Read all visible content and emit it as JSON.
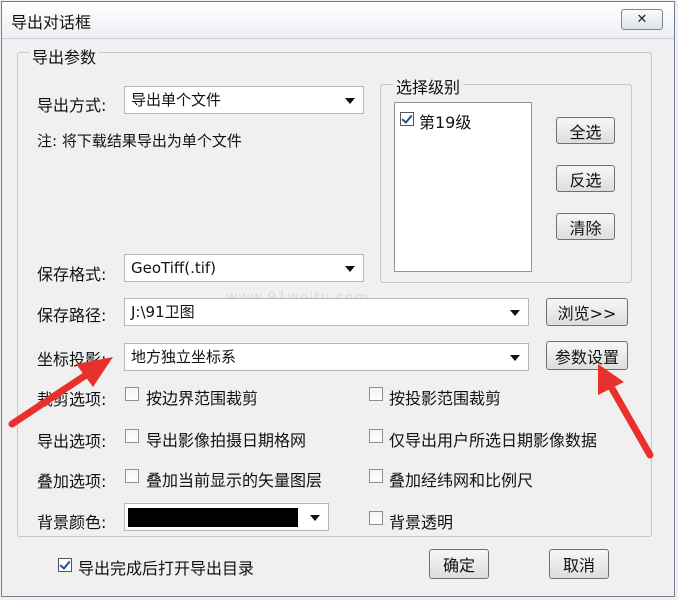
{
  "window": {
    "title": "导出对话框",
    "close_icon": "close-icon"
  },
  "export_params": {
    "legend": "导出参数",
    "export_mode_label": "导出方式:",
    "export_mode_value": "导出单个文件",
    "note": "注: 将下载结果导出为单个文件",
    "save_format_label": "保存格式:",
    "save_format_value": "GeoTiff(.tif)",
    "save_path_label": "保存路径:",
    "save_path_value": "J:\\91卫图",
    "browse_label": "浏览>>",
    "coord_label": "坐标投影:",
    "coord_value": "地方独立坐标系",
    "params_settings_label": "参数设置"
  },
  "level_select": {
    "legend": "选择级别",
    "items": [
      {
        "label": "第19级",
        "checked": true
      }
    ],
    "select_all": "全选",
    "invert": "反选",
    "clear": "清除"
  },
  "options": {
    "crop_label": "裁剪选项:",
    "crop_by_boundary": "按边界范围裁剪",
    "crop_by_projection": "按投影范围裁剪",
    "export_label": "导出选项:",
    "export_date_grid": "导出影像拍摄日期格网",
    "export_selected_date": "仅导出用户所选日期影像数据",
    "overlay_label": "叠加选项:",
    "overlay_vector": "叠加当前显示的矢量图层",
    "overlay_graticule": "叠加经纬网和比例尺",
    "bg_color_label": "背景颜色:",
    "bg_color": "#000000",
    "bg_transparent": "背景透明"
  },
  "footer": {
    "open_dir_after_export": "导出完成后打开导出目录",
    "open_dir_checked": true,
    "ok": "确定",
    "cancel": "取消"
  },
  "watermark": "www.91weitu.com",
  "annotation_color": "#e8302c"
}
